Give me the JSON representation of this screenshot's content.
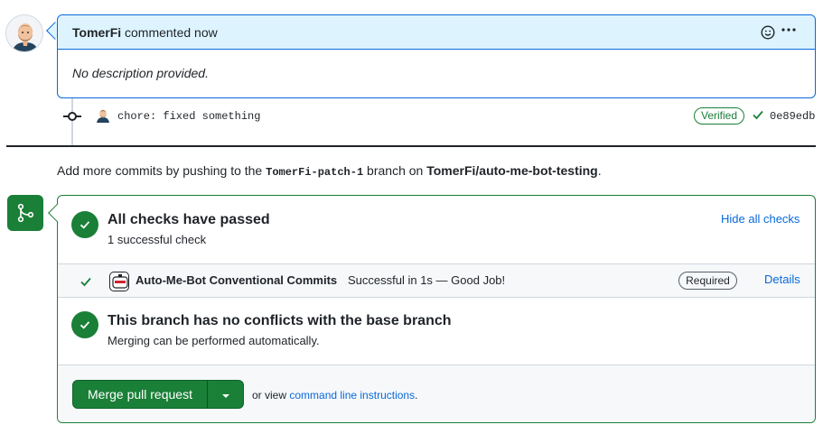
{
  "comment": {
    "author": "TomerFi",
    "action": "commented now",
    "body": "No description provided."
  },
  "commit": {
    "message": "chore: fixed something",
    "badge": "Verified",
    "sha": "0e89edb"
  },
  "add_more": {
    "prefix": "Add more commits by pushing to the",
    "branch": "TomerFi-patch-1",
    "middle": "branch on",
    "repo": "TomerFi/auto-me-bot-testing",
    "suffix": "."
  },
  "checks": {
    "title": "All checks have passed",
    "subtitle": "1 successful check",
    "toggle_label": "Hide all checks",
    "items": [
      {
        "name": "Auto-Me-Bot Conventional Commits",
        "status": "Successful in 1s — Good Job!",
        "badge": "Required",
        "link": "Details"
      }
    ]
  },
  "conflicts": {
    "title": "This branch has no conflicts with the base branch",
    "subtitle": "Merging can be performed automatically."
  },
  "merge": {
    "button_label": "Merge pull request",
    "or_view": "or view",
    "cli_link": "command line instructions",
    "suffix": "."
  },
  "colors": {
    "success": "#1a7f37",
    "link": "#0969da",
    "comment_header_bg": "#ddf4ff"
  },
  "icons": [
    "avatar",
    "smiley-icon",
    "kebab-horizontal-icon",
    "git-commit-icon",
    "check-icon",
    "git-merge-icon",
    "triangle-down-icon"
  ]
}
